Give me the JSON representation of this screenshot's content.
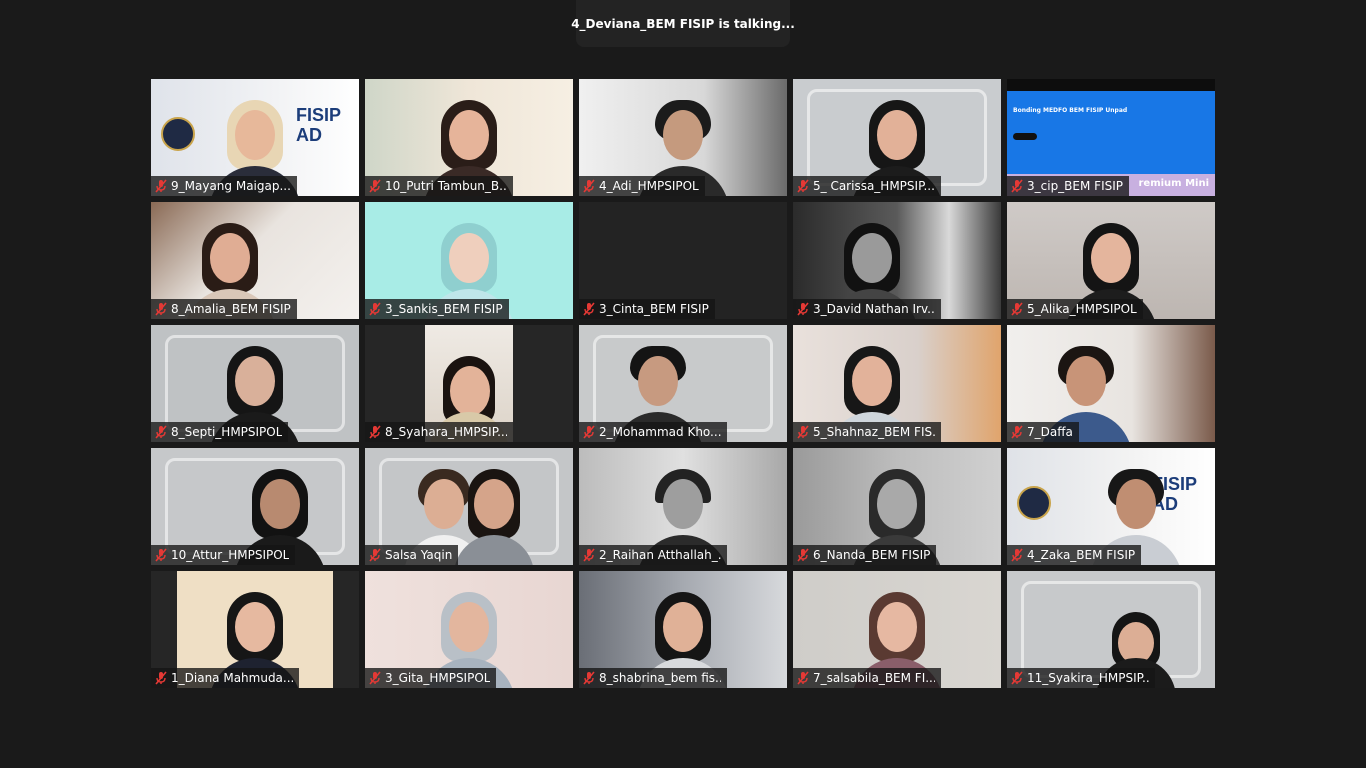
{
  "banner": {
    "text": "4_Deviana_BEM FISIP is talking..."
  },
  "colors": {
    "muted_mic": "#e53935",
    "background": "#1a1a1a"
  },
  "participants": [
    {
      "name": "9_Mayang Maigap..."
    },
    {
      "name": "10_Putri Tambun_B..."
    },
    {
      "name": "4_Adi_HMPSIPOL"
    },
    {
      "name": "5_ Carissa_HMPSIP..."
    },
    {
      "name": "3_cip_BEM FISIP",
      "screen_text": {
        "title": "Bonding MEDFO BEM FISIP Unpad",
        "footer": "remium Mini"
      }
    },
    {
      "name": "8_Amalia_BEM FISIP"
    },
    {
      "name": "3_Sankis_BEM FISIP"
    },
    {
      "name": "3_Cinta_BEM FISIP"
    },
    {
      "name": "3_David Nathan Irv..."
    },
    {
      "name": "5_Alika_HMPSIPOL"
    },
    {
      "name": "8_Septi_HMPSIPOL"
    },
    {
      "name": "8_Syahara_HMPSIP..."
    },
    {
      "name": "2_Mohammad Kho..."
    },
    {
      "name": "5_Shahnaz_BEM FIS..."
    },
    {
      "name": "7_Daffa"
    },
    {
      "name": "10_Attur_HMPSIPOL"
    },
    {
      "name": "Salsa Yaqin"
    },
    {
      "name": "2_Raihan Atthallah_..."
    },
    {
      "name": "6_Nanda_BEM FISIP"
    },
    {
      "name": "4_Zaka_BEM FISIP"
    },
    {
      "name": "1_Diana Mahmuda..."
    },
    {
      "name": "3_Gita_HMPSIPOL"
    },
    {
      "name": "8_shabrina_bem fis..."
    },
    {
      "name": "7_salsabila_BEM FI..."
    },
    {
      "name": "11_Syakira_HMPSIP..."
    }
  ]
}
